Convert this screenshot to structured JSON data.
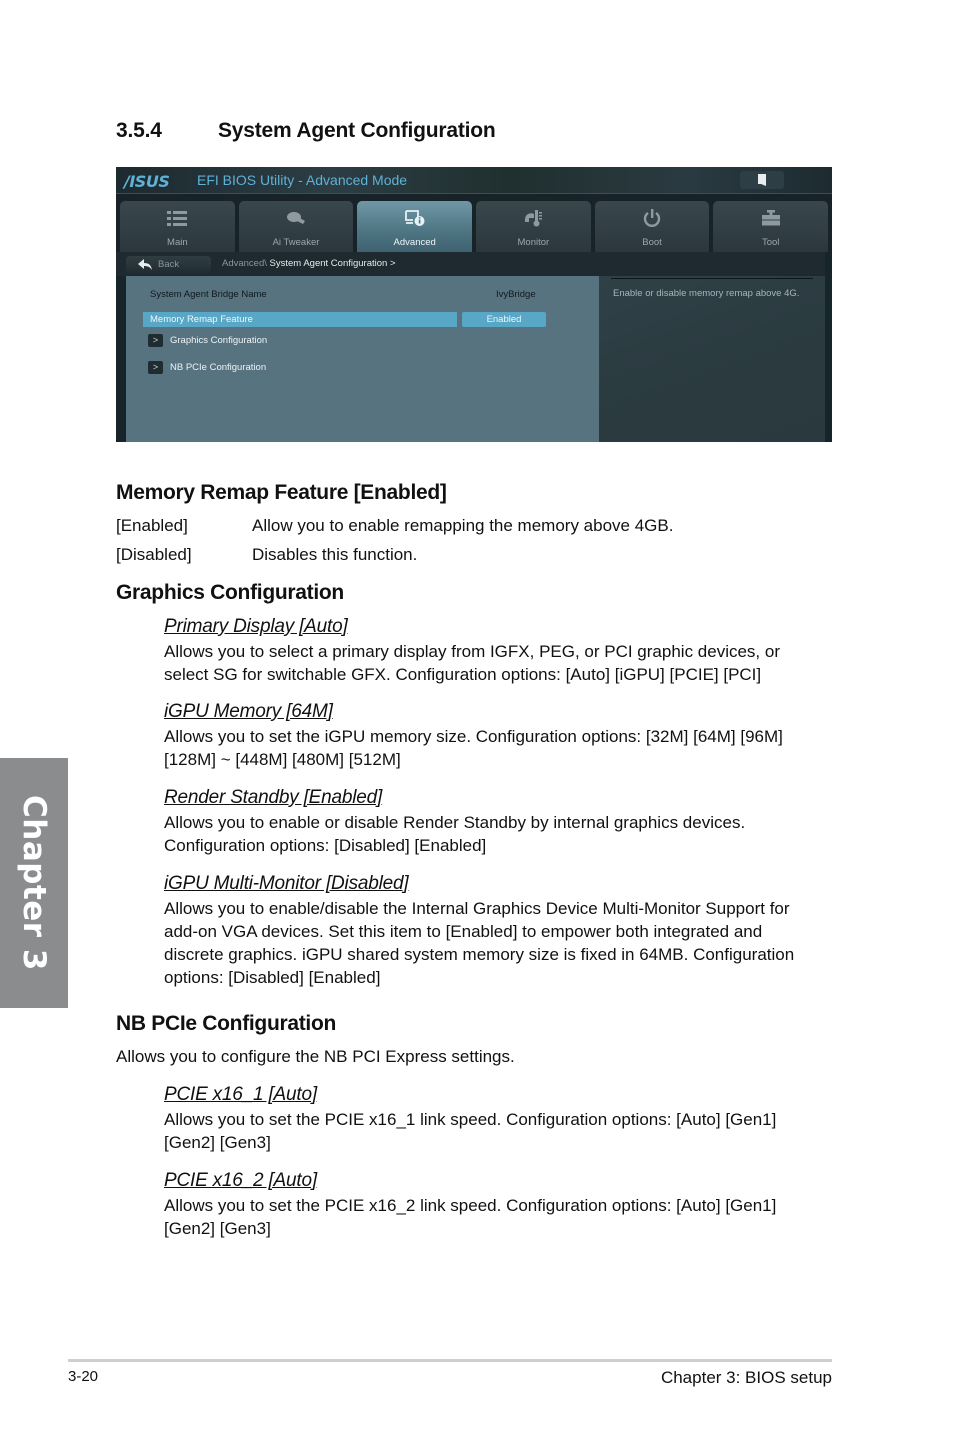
{
  "section": {
    "number": "3.5.4",
    "title": "System Agent Configuration"
  },
  "bios": {
    "logo": "/ISUS",
    "title": "EFI BIOS Utility - Advanced Mode",
    "colors": {
      "accent": "#58a7c6",
      "panel": "#587380",
      "title": "#5fb1d6"
    },
    "tabs": [
      {
        "label": "Main",
        "icon": "list-icon",
        "active": false
      },
      {
        "label": "Ai  Tweaker",
        "icon": "fan-icon",
        "active": false
      },
      {
        "label": "Advanced",
        "icon": "advanced-info-icon",
        "active": true
      },
      {
        "label": "Monitor",
        "icon": "thermometer-icon",
        "active": false
      },
      {
        "label": "Boot",
        "icon": "power-icon",
        "active": false
      },
      {
        "label": "Tool",
        "icon": "toolbox-icon",
        "active": false
      }
    ],
    "back_label": "Back",
    "breadcrumb_parent": "Advanced\\",
    "breadcrumb_current": "System Agent Configuration  >",
    "bridge_label": "System Agent Bridge Name",
    "bridge_value": "IvyBridge",
    "selected_item": {
      "label": "Memory Remap Feature",
      "value": "Enabled"
    },
    "submenus": [
      {
        "chevron": ">",
        "label": "Graphics Configuration"
      },
      {
        "chevron": ">",
        "label": "NB PCIe Configuration"
      }
    ],
    "help_text": "Enable or disable memory remap above 4G."
  },
  "memory_remap": {
    "heading": "Memory Remap Feature [Enabled]",
    "options": [
      {
        "key": "[Enabled]",
        "desc": "Allow you to enable remapping the memory above 4GB."
      },
      {
        "key": "[Disabled]",
        "desc": "Disables this function."
      }
    ]
  },
  "graphics": {
    "heading": "Graphics Configuration",
    "items": [
      {
        "title": "Primary Display [Auto]",
        "body": "Allows you to select a primary display from IGFX, PEG, or PCI graphic devices, or select SG for switchable GFX. Configuration options: [Auto] [iGPU] [PCIE] [PCI]"
      },
      {
        "title": "iGPU Memory [64M]",
        "body": "Allows you to set the iGPU memory size. Configuration options: [32M] [64M] [96M] [128M] ~ [448M] [480M] [512M]"
      },
      {
        "title": "Render Standby [Enabled]",
        "body": "Allows you to enable or disable Render Standby by internal graphics devices. Configuration options: [Disabled] [Enabled]"
      },
      {
        "title": "iGPU Multi-Monitor [Disabled]",
        "body": "Allows you to enable/disable the Internal Graphics Device Multi-Monitor Support for add-on VGA devices. Set this item to [Enabled] to empower both integrated and discrete graphics. iGPU shared system memory size is fixed in 64MB. Configuration options: [Disabled] [Enabled]"
      }
    ]
  },
  "nb_pcie": {
    "heading": "NB PCIe Configuration",
    "intro": "Allows you to configure the NB PCI Express settings.",
    "items": [
      {
        "title": "PCIE x16_1 [Auto]",
        "body": "Allows you to set the PCIE x16_1 link speed. Configuration options: [Auto] [Gen1] [Gen2] [Gen3]"
      },
      {
        "title": "PCIE x16_2 [Auto]",
        "body": "Allows you to set the PCIE x16_2 link speed. Configuration options: [Auto] [Gen1] [Gen2] [Gen3]"
      }
    ]
  },
  "chapter_tab": "Chapter 3",
  "footer": {
    "page": "3-20",
    "title": "Chapter 3: BIOS setup"
  }
}
